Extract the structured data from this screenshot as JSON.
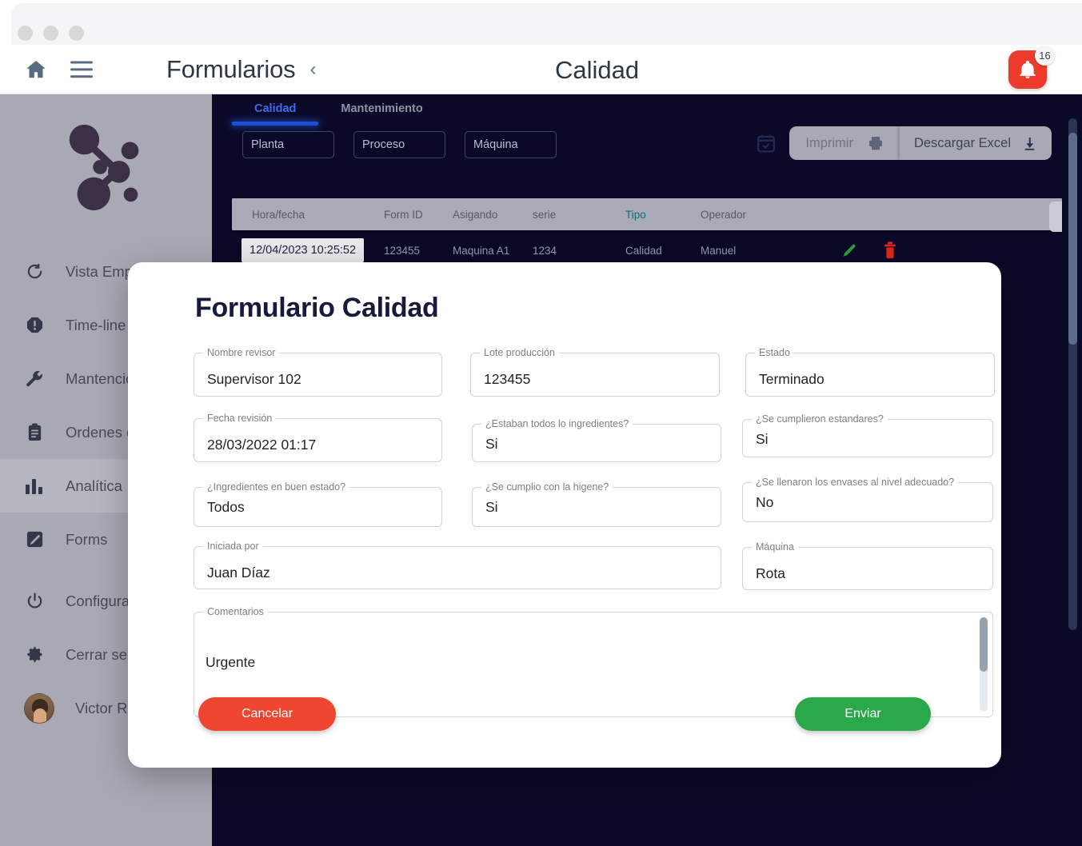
{
  "window": {
    "dots": 3
  },
  "header": {
    "home_icon": "home-icon",
    "menu_icon": "hamburger-menu-icon",
    "title": "Formularios",
    "back_chevron": "‹",
    "center_title": "Calidad",
    "bell_icon": "bell-icon",
    "notification_count": "16",
    "accent_red": "#ec3b2b"
  },
  "sidebar": {
    "logo": "network-nodes-logo",
    "items": [
      {
        "label": "Vista Empresa",
        "icon": "refresh-circle-icon",
        "active": false
      },
      {
        "label": "Time-line",
        "icon": "alert-octagon-icon",
        "active": false
      },
      {
        "label": "Mantenciones",
        "icon": "wrench-icon",
        "active": false
      },
      {
        "label": "Ordenes de trabajo",
        "icon": "clipboard-icon",
        "active": false
      },
      {
        "label": "Analítica",
        "icon": "bar-chart-icon",
        "active": true
      },
      {
        "label": "Forms",
        "icon": "edit-square-icon",
        "active": false
      }
    ],
    "bottom_items": [
      {
        "label": "Configuración",
        "icon": "power-icon"
      },
      {
        "label": "Cerrar sesión",
        "icon": "gear-icon"
      },
      {
        "label": "Victor Ruz",
        "icon": "avatar"
      }
    ],
    "bg_color": "#a8a9b4"
  },
  "main": {
    "bg_color": "#0a0a28",
    "tabs": [
      {
        "label": "Calidad",
        "active": true
      },
      {
        "label": "Mantenimiento",
        "active": false
      }
    ],
    "filters": [
      {
        "label": "Planta"
      },
      {
        "label": "Proceso"
      },
      {
        "label": "Máquina"
      }
    ],
    "actions": {
      "calendar_icon": "calendar-check-icon",
      "print_label": "Imprimir",
      "print_icon": "printer-icon",
      "excel_label": "Descargar Excel",
      "excel_icon": "download-icon"
    },
    "table": {
      "columns": [
        "Hora/fecha",
        "Form ID",
        "Asigando",
        "serie",
        "Tipo",
        "Operador"
      ],
      "highlight_column": "Tipo",
      "rows": [
        {
          "hora_fecha": "12/04/2023 10:25:52",
          "form_id": "123455",
          "asigando": "Maquina A1",
          "serie": "1234",
          "tipo": "Calidad",
          "operador": "Manuel",
          "edit_icon": "pencil-icon",
          "delete_icon": "trash-icon"
        }
      ]
    }
  },
  "modal": {
    "title": "Formulario Calidad",
    "fields": [
      {
        "legend": "Nombre revisor",
        "value": "Supervisor 102"
      },
      {
        "legend": "Lote producción",
        "value": "123455"
      },
      {
        "legend": "Estado",
        "value": "Terminado"
      },
      {
        "legend": "Fecha revisión",
        "value": "28/03/2022 01:17"
      },
      {
        "legend": "¿Estaban todos lo ingredientes?",
        "value": "Si"
      },
      {
        "legend": "¿Se cumplieron estandares?",
        "value": "Si"
      },
      {
        "legend": "¿Ingredientes en buen estado?",
        "value": "Todos"
      },
      {
        "legend": "¿Se cumplio con la higene?",
        "value": "Si"
      },
      {
        "legend": "¿Se llenaron los envases al nivel adecuado?",
        "value": "No"
      },
      {
        "legend": "Iniciada por",
        "value": "Juan Díaz"
      },
      {
        "legend": "Máquina",
        "value": "Rota"
      }
    ],
    "comments": {
      "legend": "Comentarios",
      "value": "Urgente"
    },
    "cancel_label": "Cancelar",
    "submit_label": "Enviar",
    "cancel_color": "#ee4630",
    "submit_color": "#2aa84a"
  }
}
